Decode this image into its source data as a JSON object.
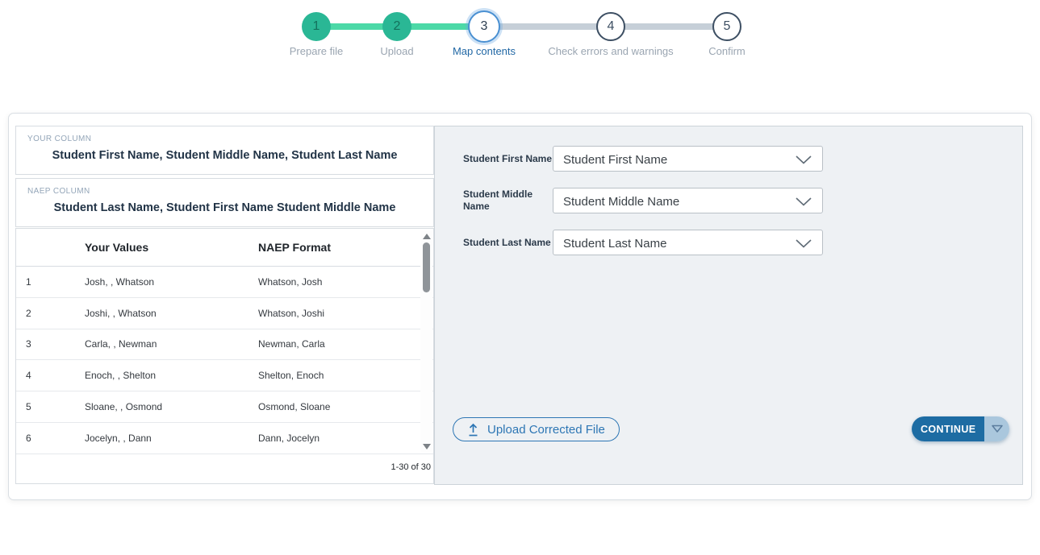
{
  "stepper": {
    "steps": [
      {
        "number": "1",
        "label": "Prepare file",
        "state": "complete"
      },
      {
        "number": "2",
        "label": "Upload",
        "state": "complete"
      },
      {
        "number": "3",
        "label": "Map contents",
        "state": "active"
      },
      {
        "number": "4",
        "label": "Check errors and warnings",
        "state": "upcoming"
      },
      {
        "number": "5",
        "label": "Confirm",
        "state": "upcoming"
      }
    ]
  },
  "mapping": {
    "your_column_label": "YOUR COLUMN",
    "your_column_value": "Student First Name, Student Middle Name, Student Last Name",
    "naep_column_label": "NAEP COLUMN",
    "naep_column_value": "Student Last Name, Student First Name Student Middle Name"
  },
  "table": {
    "headers": {
      "your_values": "Your Values",
      "naep_format": "NAEP Format"
    },
    "rows": [
      {
        "index": "1",
        "your_value": "Josh, , Whatson",
        "naep_format": "Whatson, Josh"
      },
      {
        "index": "2",
        "your_value": "Joshi, , Whatson",
        "naep_format": "Whatson, Joshi"
      },
      {
        "index": "3",
        "your_value": "Carla, , Newman",
        "naep_format": "Newman, Carla"
      },
      {
        "index": "4",
        "your_value": "Enoch, , Shelton",
        "naep_format": "Shelton, Enoch"
      },
      {
        "index": "5",
        "your_value": "Sloane, , Osmond",
        "naep_format": "Osmond, Sloane"
      },
      {
        "index": "6",
        "your_value": "Jocelyn, , Dann",
        "naep_format": "Dann, Jocelyn"
      }
    ],
    "pagination": "1-30 of 30"
  },
  "form": {
    "fields": [
      {
        "label": "Student First Name",
        "value": "Student First Name"
      },
      {
        "label": "Student Middle Name",
        "value": "Student Middle Name"
      },
      {
        "label": "Student Last Name",
        "value": "Student Last Name"
      }
    ],
    "upload_button_label": "Upload Corrected File",
    "continue_button_label": "CONTINUE"
  },
  "icons": {
    "dropdown_chevron": "chevron-down",
    "upload": "upload-arrow",
    "continue_menu": "triangle-down",
    "scrollbar_up": "triangle-up",
    "scrollbar_down": "triangle-down"
  },
  "colors": {
    "step_complete_green": "#2ab795",
    "connector_green": "#4cd9a7",
    "connector_gray": "#c6cfd8",
    "active_step_blue": "#4a90d2",
    "active_label_blue": "#2268a5",
    "panel_background": "#eef1f4",
    "primary_button_blue": "#1d6ca3",
    "split_button_light_blue": "#aac7dd",
    "outline_button_blue": "#2d76b4"
  }
}
